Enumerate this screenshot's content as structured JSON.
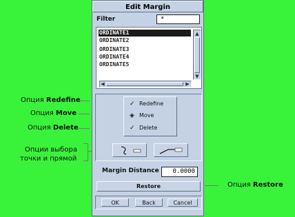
{
  "dialog": {
    "title": "Edit Margin",
    "filter_label": "Filter",
    "filter_value": "*",
    "list_items": [
      "ORDINATE1",
      "ORDINATE2",
      "ORDINATE3",
      "ORDINATE4",
      "ORDINATE5"
    ],
    "options": [
      "Redefine",
      "Move",
      "Delete"
    ],
    "selected_option": "Move",
    "margin_distance_label": "Margin Distance",
    "margin_distance_value": "0.0000",
    "restore_label": "Restore",
    "ok_label": "OK",
    "back_label": "Back",
    "cancel_label": "Cancel"
  },
  "annotations": {
    "redefine_prefix": "Опция ",
    "redefine_bold": "Redefine",
    "move_prefix": "Опция ",
    "move_bold": "Move",
    "delete_prefix": "Опция ",
    "delete_bold": "Delete",
    "pick_line1": "Опции выбора",
    "pick_line2": "точки и прямой",
    "restore_prefix": "Опция ",
    "restore_bold": "Restore"
  },
  "colors": {
    "background": "#39f33a",
    "dialog": "#c4d2e4"
  }
}
